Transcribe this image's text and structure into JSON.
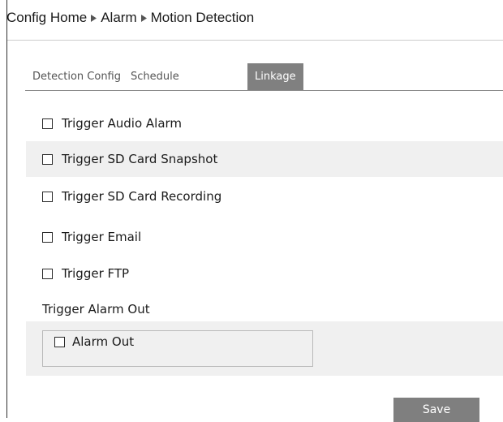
{
  "breadcrumb": {
    "items": [
      "Config Home",
      "Alarm",
      "Motion Detection"
    ],
    "separator_icon": "triangle-right-icon"
  },
  "tabs": [
    {
      "label": "Detection Config",
      "active": false
    },
    {
      "label": "Schedule",
      "active": false
    },
    {
      "label": "Linkage",
      "active": true
    }
  ],
  "options": [
    {
      "label": "Trigger Audio Alarm",
      "checked": false
    },
    {
      "label": "Trigger SD Card Snapshot",
      "checked": false
    },
    {
      "label": "Trigger SD Card Recording",
      "checked": false
    },
    {
      "label": "Trigger Email",
      "checked": false
    },
    {
      "label": "Trigger FTP",
      "checked": false
    }
  ],
  "alarm_out": {
    "section_label": "Trigger Alarm Out",
    "item_label": "Alarm Out",
    "checked": false
  },
  "actions": {
    "save_label": "Save"
  },
  "colors": {
    "tab_active_bg": "#808080",
    "row_shade": "#f0f0f0",
    "button_bg": "#7f7f7f"
  }
}
